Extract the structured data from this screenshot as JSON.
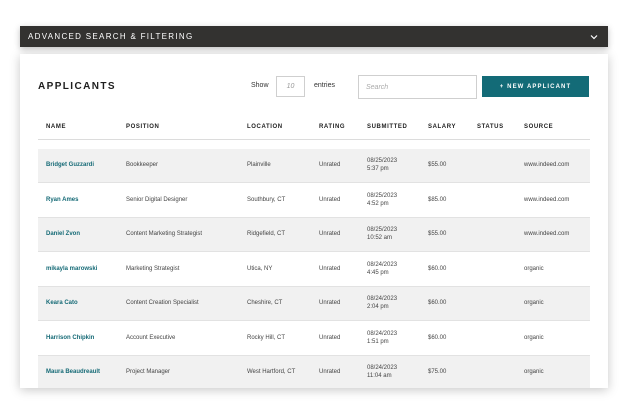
{
  "filter_bar": {
    "title": "ADVANCED SEARCH & FILTERING"
  },
  "card": {
    "title": "APPLICANTS",
    "show_label": "Show",
    "show_value": "10",
    "entries_label": "entries",
    "search_placeholder": "Search",
    "new_button": "+ NEW APPLICANT"
  },
  "columns": [
    "NAME",
    "POSITION",
    "LOCATION",
    "RATING",
    "SUBMITTED",
    "SALARY",
    "STATUS",
    "SOURCE"
  ],
  "rows": [
    {
      "name": "Bridget Guzzardi",
      "position": "Bookkeeper",
      "location": "Plainville",
      "rating": "Unrated",
      "date": "08/25/2023",
      "time": "5:37 pm",
      "salary": "$55.00",
      "status": "",
      "source": "www.indeed.com"
    },
    {
      "name": "Ryan Ames",
      "position": "Senior Digital Designer",
      "location": "Southbury, CT",
      "rating": "Unrated",
      "date": "08/25/2023",
      "time": "4:52 pm",
      "salary": "$85.00",
      "status": "",
      "source": "www.indeed.com"
    },
    {
      "name": "Daniel Zvon",
      "position": "Content Marketing Strategist",
      "location": "Ridgefield, CT",
      "rating": "Unrated",
      "date": "08/25/2023",
      "time": "10:52 am",
      "salary": "$55.00",
      "status": "",
      "source": "www.indeed.com"
    },
    {
      "name": "mikayla marowski",
      "position": "Marketing Strategist",
      "location": "Utica, NY",
      "rating": "Unrated",
      "date": "08/24/2023",
      "time": "4:45 pm",
      "salary": "$60.00",
      "status": "",
      "source": "organic"
    },
    {
      "name": "Keara Cato",
      "position": "Content Creation Specialist",
      "location": "Cheshire, CT",
      "rating": "Unrated",
      "date": "08/24/2023",
      "time": "2:04 pm",
      "salary": "$60.00",
      "status": "",
      "source": "organic"
    },
    {
      "name": "Harrison Chipkin",
      "position": "Account Executive",
      "location": "Rocky Hill, CT",
      "rating": "Unrated",
      "date": "08/24/2023",
      "time": "1:51 pm",
      "salary": "$60.00",
      "status": "",
      "source": "organic"
    },
    {
      "name": "Maura Beaudreault",
      "position": "Project Manager",
      "location": "West Hartford, CT",
      "rating": "Unrated",
      "date": "08/24/2023",
      "time": "11:04 am",
      "salary": "$75.00",
      "status": "",
      "source": "organic"
    }
  ],
  "colors": {
    "accent": "#136b77",
    "name_link": "#156a76",
    "filter_bar_bg": "#333230",
    "row_alt": "#f1f1f1"
  },
  "icons": {
    "filter_toggle": "chevron-down-icon"
  }
}
